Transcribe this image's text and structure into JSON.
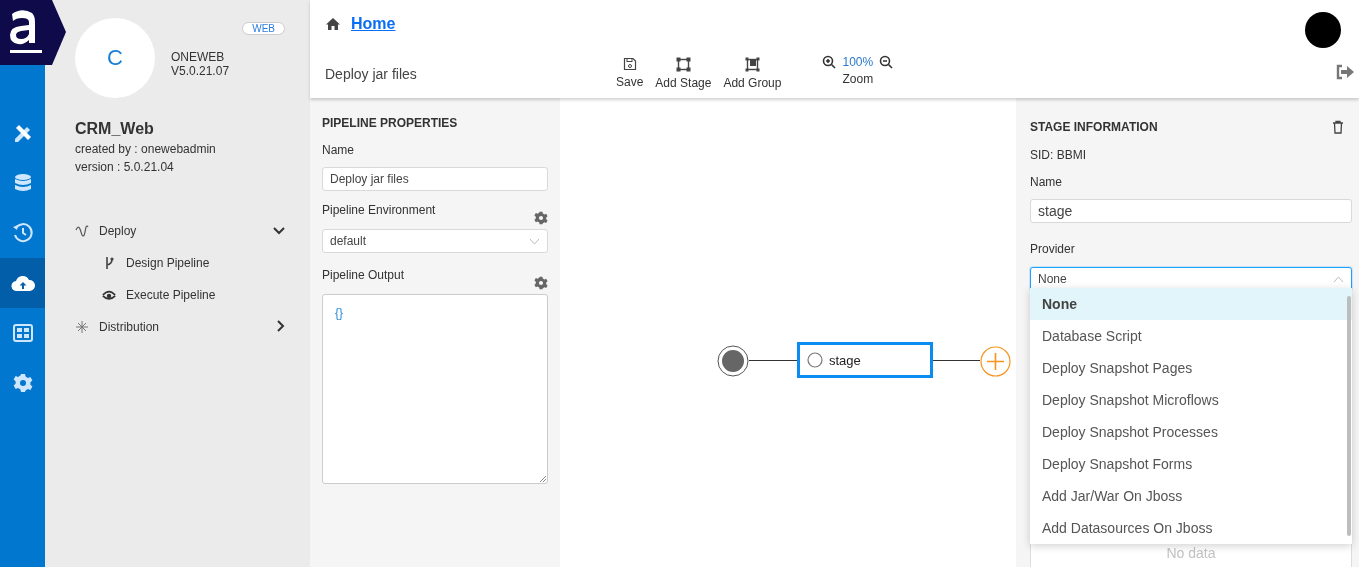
{
  "rail": {
    "items": [
      {
        "kind": "tools",
        "selected": false
      },
      {
        "kind": "database",
        "selected": false
      },
      {
        "kind": "history",
        "selected": false
      },
      {
        "kind": "upload",
        "selected": true
      },
      {
        "kind": "dashboard",
        "selected": false
      },
      {
        "kind": "settings",
        "selected": false
      }
    ]
  },
  "project": {
    "avatar": "C",
    "badge": "WEB",
    "platform": "ONEWEB V5.0.21.07",
    "name": "CRM_Web",
    "created_by": "created by : onewebadmin",
    "version": "version : 5.0.21.04"
  },
  "nav": [
    {
      "label": "Deploy",
      "kind": "wave",
      "expanded": true,
      "children": [
        {
          "label": "Design Pipeline",
          "kind": "branch"
        },
        {
          "label": "Execute Pipeline",
          "kind": "eye"
        }
      ]
    },
    {
      "label": "Distribution",
      "kind": "spark",
      "expanded": false
    }
  ],
  "breadcrumb": {
    "label": "Home"
  },
  "pipeline_title": "Deploy jar files",
  "toolbar": [
    {
      "kind": "save",
      "label": "Save"
    },
    {
      "kind": "stage",
      "label": "Add Stage"
    },
    {
      "kind": "group",
      "label": "Add Group"
    }
  ],
  "zoom": {
    "value": "100%",
    "label": "Zoom"
  },
  "properties": {
    "title": "PIPELINE PROPERTIES",
    "name_label": "Name",
    "name_value": "Deploy jar files",
    "env_label": "Pipeline Environment",
    "env_value": "default",
    "output_label": "Pipeline Output",
    "output_value": "{}"
  },
  "canvas": {
    "stages": [
      {
        "label": "stage",
        "selected": true
      }
    ]
  },
  "stage_info": {
    "title": "STAGE INFORMATION",
    "sid": "SID: BBMI",
    "name_label": "Name",
    "name_value": "stage",
    "provider_label": "Provider",
    "provider_value": "None",
    "provider_open": true,
    "options": [
      {
        "label": "None",
        "selected": true
      },
      {
        "label": "Database Script",
        "selected": false
      },
      {
        "label": "Deploy Snapshot Pages",
        "selected": false
      },
      {
        "label": "Deploy Snapshot Microflows",
        "selected": false
      },
      {
        "label": "Deploy Snapshot Processes",
        "selected": false
      },
      {
        "label": "Deploy Snapshot Forms",
        "selected": false
      },
      {
        "label": "Add Jar/War On Jboss",
        "selected": false
      },
      {
        "label": "Add Datasources On Jboss",
        "selected": false
      }
    ],
    "empty_text": "No data"
  }
}
